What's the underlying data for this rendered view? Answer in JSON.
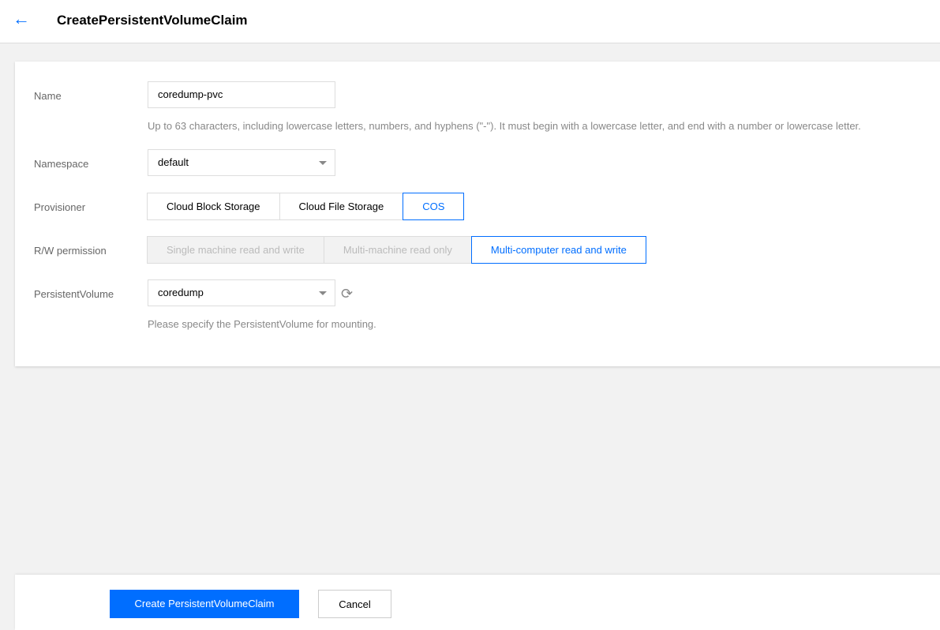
{
  "header": {
    "title": "CreatePersistentVolumeClaim"
  },
  "form": {
    "name": {
      "label": "Name",
      "value": "coredump-pvc",
      "hint": "Up to 63 characters, including lowercase letters, numbers, and hyphens (\"-\"). It must begin with a lowercase letter, and end with a number or lowercase letter."
    },
    "namespace": {
      "label": "Namespace",
      "value": "default"
    },
    "provisioner": {
      "label": "Provisioner",
      "options": [
        "Cloud Block Storage",
        "Cloud File Storage",
        "COS"
      ],
      "selected": "COS"
    },
    "rw": {
      "label": "R/W permission",
      "options": [
        "Single machine read and write",
        "Multi-machine read only",
        "Multi-computer read and write"
      ],
      "selected": "Multi-computer read and write"
    },
    "pv": {
      "label": "PersistentVolume",
      "value": "coredump",
      "hint": "Please specify the PersistentVolume for mounting."
    }
  },
  "footer": {
    "create": "Create PersistentVolumeClaim",
    "cancel": "Cancel"
  }
}
